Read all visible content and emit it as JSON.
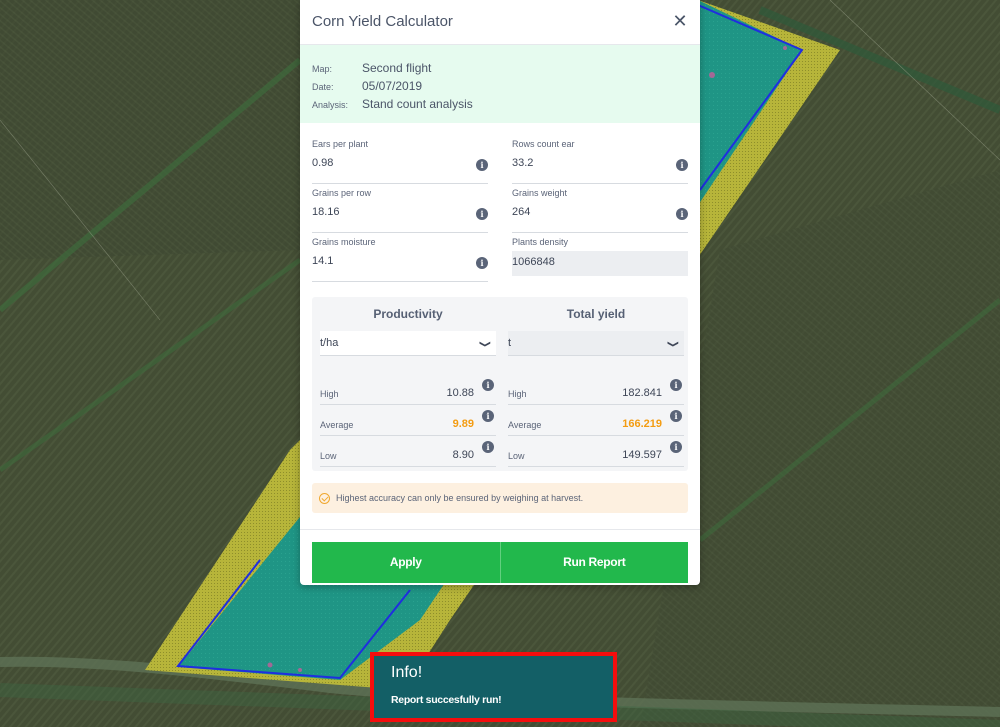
{
  "modal": {
    "title": "Corn Yield Calculator",
    "close_icon": "close-icon",
    "info": [
      {
        "label": "Map:",
        "value": "Second flight"
      },
      {
        "label": "Date:",
        "value": "05/07/2019"
      },
      {
        "label": "Analysis:",
        "value": "Stand count analysis"
      }
    ],
    "fields": [
      {
        "label": "Ears per plant",
        "value": "0.98",
        "has_info": true,
        "readonly": false
      },
      {
        "label": "Rows count ear",
        "value": "33.2",
        "has_info": true,
        "readonly": false
      },
      {
        "label": "Grains per row",
        "value": "18.16",
        "has_info": true,
        "readonly": false
      },
      {
        "label": "Grains weight",
        "value": "264",
        "has_info": true,
        "readonly": false
      },
      {
        "label": "Grains moisture",
        "value": "14.1",
        "has_info": true,
        "readonly": false
      },
      {
        "label": "Plants density",
        "value": "1066848",
        "has_info": false,
        "readonly": true
      }
    ],
    "results": {
      "productivity": {
        "title": "Productivity",
        "unit": "t/ha",
        "rows": [
          {
            "label": "High",
            "value": "10.88"
          },
          {
            "label": "Average",
            "value": "9.89"
          },
          {
            "label": "Low",
            "value": "8.90"
          }
        ]
      },
      "total_yield": {
        "title": "Total yield",
        "unit": "t",
        "rows": [
          {
            "label": "High",
            "value": "182.841"
          },
          {
            "label": "Average",
            "value": "166.219"
          },
          {
            "label": "Low",
            "value": "149.597"
          }
        ]
      }
    },
    "notice": "Highest accuracy can only be ensured by weighing at harvest.",
    "buttons": {
      "apply": "Apply",
      "run_report": "Run Report"
    }
  },
  "toast": {
    "title": "Info!",
    "message": "Report succesfully run!"
  },
  "colors": {
    "accent_green": "#22b84c",
    "average_highlight": "#f39c12",
    "toast_bg": "#135f66",
    "toast_border": "#f50d0d",
    "info_bg": "#e6fbef",
    "notice_bg": "#fdf0e0"
  },
  "icons": {
    "info": "info-icon",
    "chevron": "chevron-down-icon",
    "check": "check-circle-icon"
  }
}
